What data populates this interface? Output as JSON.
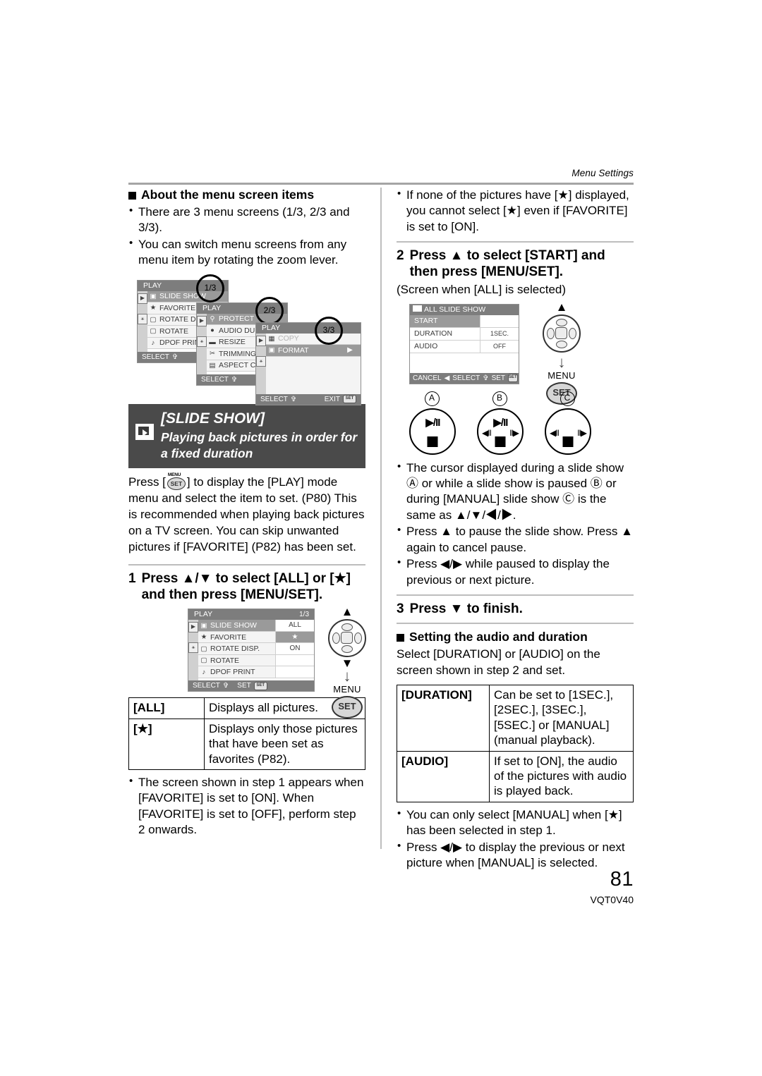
{
  "running_head": "Menu Settings",
  "left_column": {
    "section_heading": "About the menu screen items",
    "bullets": [
      "There are 3 menu screens (1/3, 2/3 and 3/3).",
      "You can switch menu screens from any menu item by rotating the zoom lever."
    ],
    "menu_screens": [
      {
        "title": "PLAY",
        "page": "1/3",
        "page_num": "1",
        "page_den": "3",
        "rows": [
          {
            "icon": "slideshow-icon",
            "label": "SLIDE SHOW",
            "selected": true
          },
          {
            "icon": "star-icon",
            "label": "FAVORITE",
            "selected": false
          },
          {
            "icon": "rotate-disp-icon",
            "label": "ROTATE DIS",
            "selected": false
          },
          {
            "icon": "rotate-icon",
            "label": "ROTATE",
            "selected": false
          },
          {
            "icon": "dpof-icon",
            "label": "DPOF PRINT",
            "selected": false
          }
        ],
        "footer_left": "SELECT"
      },
      {
        "title": "PLAY",
        "page": "2/3",
        "page_num": "2",
        "page_den": "3",
        "rows": [
          {
            "icon": "key-icon",
            "label": "PROTECT",
            "selected": true
          },
          {
            "icon": "mic-icon",
            "label": "AUDIO DUB.",
            "selected": false
          },
          {
            "icon": "resize-icon",
            "label": "RESIZE",
            "selected": false
          },
          {
            "icon": "scissors-icon",
            "label": "TRIMMING",
            "selected": false
          },
          {
            "icon": "aspect-icon",
            "label": "ASPECT CON",
            "selected": false
          }
        ],
        "footer_left": "SELECT"
      },
      {
        "title": "PLAY",
        "page": "3/3",
        "page_num": "3",
        "page_den": "3",
        "rows": [
          {
            "icon": "copy-icon",
            "label": "COPY",
            "selected": false,
            "dim": true
          },
          {
            "icon": "format-icon",
            "label": "FORMAT",
            "selected": true
          }
        ],
        "footer_left": "SELECT",
        "footer_right": "EXIT"
      }
    ],
    "banner": {
      "icon": "slideshow-icon",
      "title": "[SLIDE SHOW]",
      "subtitle": "Playing back pictures in order for a fixed duration"
    },
    "intro_parts": {
      "p1": "Press [",
      "p2": "] to display the [PLAY] mode menu and select the item to set. (P80) This is recommended when playing back pictures on a TV screen. You can skip unwanted pictures if [FAVORITE] (P82) has been set.",
      "menu_label": "MENU",
      "set_label": "SET"
    },
    "step1": {
      "number": "1",
      "text": "Press ▲/▼ to select [ALL] or [★] and then press [MENU/SET]."
    },
    "step1_screen": {
      "title": "PLAY",
      "page_num": "1",
      "page_den": "3",
      "rows": [
        {
          "icon": "slideshow-icon",
          "label": "SLIDE SHOW",
          "value": "ALL",
          "selected": true
        },
        {
          "icon": "star-icon",
          "label": "FAVORITE",
          "value": "★",
          "value_highlight": true
        },
        {
          "icon": "rotate-disp-icon",
          "label": "ROTATE DISP.",
          "value": "ON"
        },
        {
          "icon": "rotate-icon",
          "label": "ROTATE",
          "value": ""
        },
        {
          "icon": "dpof-icon",
          "label": "DPOF PRINT",
          "value": ""
        }
      ],
      "footer_left": "SELECT",
      "footer_right": "SET"
    },
    "step1_dpad": {
      "menu_label": "MENU",
      "set_label": "SET"
    },
    "table1": {
      "rows": [
        {
          "key": "[ALL]",
          "desc": "Displays all pictures."
        },
        {
          "key": "[★]",
          "desc": "Displays only those pictures that have been set as favorites (P82)."
        }
      ]
    },
    "after_table_bullets": [
      "The screen shown in step 1 appears when [FAVORITE] is set to [ON]. When [FAVORITE] is set to [OFF], perform step 2 onwards."
    ]
  },
  "right_column": {
    "top_bullets": [
      "If none of the pictures have [★] displayed, you cannot select [★] even if [FAVORITE] is set to [ON]."
    ],
    "step2": {
      "number": "2",
      "text": "Press ▲ to select [START] and then press [MENU/SET].",
      "note": "(Screen when [ALL] is selected)"
    },
    "step2_screen": {
      "icon": "slideshow-icon",
      "title": "ALL SLIDE SHOW",
      "rows": [
        {
          "label": "START",
          "value": "",
          "selected": true
        },
        {
          "label": "DURATION",
          "value": "1SEC."
        },
        {
          "label": "AUDIO",
          "value": "OFF"
        }
      ],
      "footer_cancel": "CANCEL",
      "footer_select": "SELECT",
      "footer_set": "SET"
    },
    "step2_dpad": {
      "menu_label": "MENU",
      "set_label": "SET"
    },
    "cursor_icons": [
      {
        "label": "A",
        "play_pause": "▶/II",
        "left": "",
        "right": "",
        "stop": "stop-square"
      },
      {
        "label": "B",
        "play_pause": "▶/II",
        "left": "◀II",
        "right": "II▶",
        "stop": "stop-square"
      },
      {
        "label": "C",
        "play_pause": "",
        "left": "◀II",
        "right": "II▶",
        "stop": "stop-square"
      }
    ],
    "mid_bullets": [
      "The cursor displayed during a slide show Ⓐ or while a slide show is paused Ⓑ or during [MANUAL] slide show Ⓒ is the same as ▲/▼/◀/▶.",
      "Press ▲ to pause the slide show. Press ▲ again to cancel pause.",
      "Press ◀/▶ while paused to display the previous or next picture."
    ],
    "step3": {
      "number": "3",
      "text": "Press ▼ to finish."
    },
    "section_heading2": "Setting the audio and duration",
    "para2": "Select [DURATION] or [AUDIO] on the screen shown in step 2 and set.",
    "table2": {
      "rows": [
        {
          "key": "[DURATION]",
          "desc": "Can be set to [1SEC.], [2SEC.], [3SEC.], [5SEC.] or [MANUAL] (manual playback)."
        },
        {
          "key": "[AUDIO]",
          "desc": "If set to [ON], the audio of the pictures with audio is played back."
        }
      ]
    },
    "bottom_bullets": [
      "You can only select [MANUAL] when [★] has been selected in step 1.",
      "Press ◀/▶ to display the previous or next picture when [MANUAL] is selected."
    ]
  },
  "footer": {
    "page_number": "81",
    "model_number": "VQT0V40"
  }
}
